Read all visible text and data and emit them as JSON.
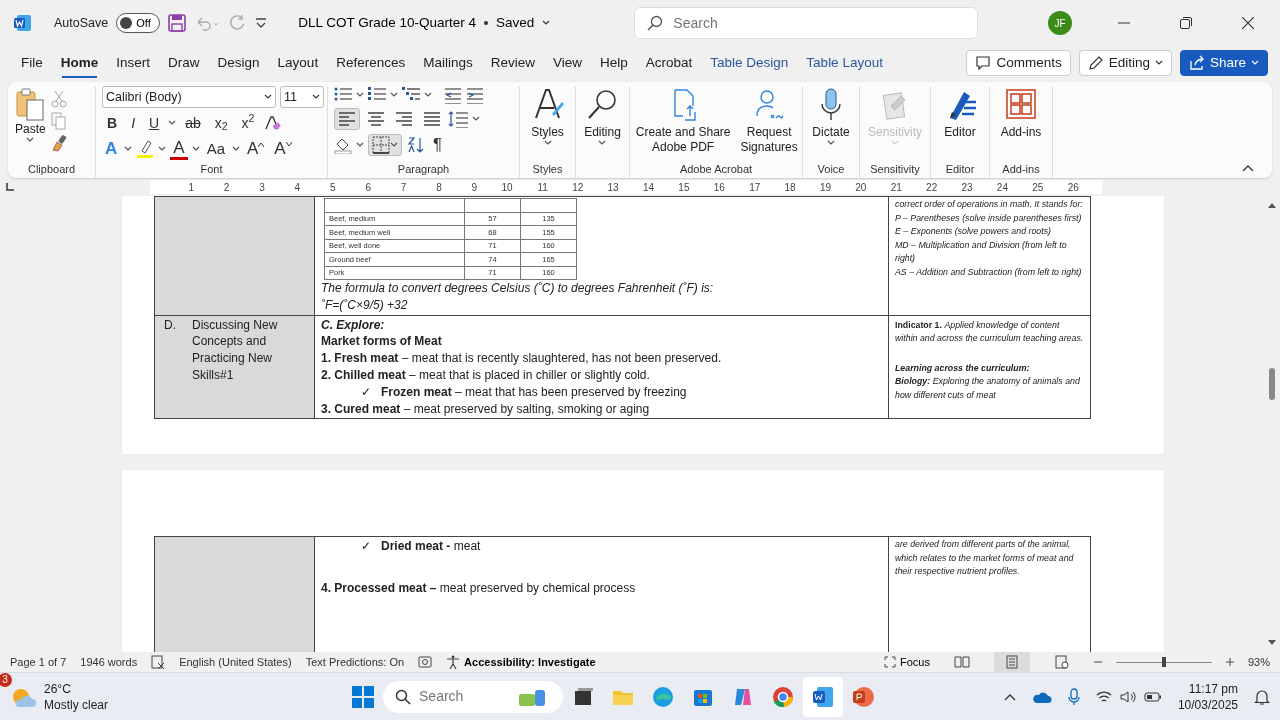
{
  "title_bar": {
    "autosave_label": "AutoSave",
    "autosave": {
      "on": false,
      "label": "Off"
    },
    "document_title": "DLL COT Grade 10-Quarter 4",
    "save_status": "Saved",
    "search": {
      "placeholder": "Search"
    },
    "avatar_initials": "JF"
  },
  "menu_tabs": [
    {
      "label": "File",
      "selected": false,
      "kind": "normal"
    },
    {
      "label": "Home",
      "selected": true,
      "kind": "normal"
    },
    {
      "label": "Insert",
      "selected": false,
      "kind": "normal"
    },
    {
      "label": "Draw",
      "selected": false,
      "kind": "normal"
    },
    {
      "label": "Design",
      "selected": false,
      "kind": "normal"
    },
    {
      "label": "Layout",
      "selected": false,
      "kind": "normal"
    },
    {
      "label": "References",
      "selected": false,
      "kind": "normal"
    },
    {
      "label": "Mailings",
      "selected": false,
      "kind": "normal"
    },
    {
      "label": "Review",
      "selected": false,
      "kind": "normal"
    },
    {
      "label": "View",
      "selected": false,
      "kind": "normal"
    },
    {
      "label": "Help",
      "selected": false,
      "kind": "normal"
    },
    {
      "label": "Acrobat",
      "selected": false,
      "kind": "normal"
    },
    {
      "label": "Table Design",
      "selected": false,
      "kind": "contextual"
    },
    {
      "label": "Table Layout",
      "selected": false,
      "kind": "contextual"
    }
  ],
  "header_buttons": [
    {
      "label": "Comments",
      "kind": "comments"
    },
    {
      "label": "Editing",
      "kind": "editing"
    },
    {
      "label": "Share",
      "kind": "share"
    }
  ],
  "ribbon": {
    "clipboard": {
      "label": "Clipboard",
      "paste": "Paste"
    },
    "font": {
      "label": "Font",
      "font_name": "Calibri (Body)",
      "font_size": "11",
      "format_buttons": [
        "B",
        "I",
        "U",
        "ab",
        "x$_{2}$",
        "x$^{2}$"
      ],
      "effect_buttons": [
        {
          "kind": "effects",
          "glyph": "A"
        },
        {
          "kind": "highlight"
        },
        {
          "kind": "color",
          "glyph": "A"
        },
        {
          "kind": "case",
          "glyph": "Aa"
        },
        {
          "kind": "grow",
          "glyph": "A"
        },
        {
          "kind": "shrink",
          "glyph": "A"
        }
      ]
    },
    "paragraph": {
      "label": "Paragraph",
      "align_buttons": [
        {
          "kind": "left",
          "selected": true
        },
        {
          "kind": "center",
          "selected": false
        },
        {
          "kind": "right",
          "selected": false
        },
        {
          "kind": "justify",
          "selected": false
        }
      ],
      "pilcrow": "¶"
    },
    "groups": [
      {
        "label": "Styles",
        "buttons": [
          {
            "label": "Styles",
            "kind": "styles",
            "dropdown": true,
            "disabled": false
          }
        ]
      },
      {
        "buttons": [
          {
            "label": "Editing",
            "kind": "search",
            "dropdown": true,
            "disabled": false
          }
        ]
      },
      {
        "label": "Adobe Acrobat",
        "buttons": [
          {
            "label": "Create and Share Adobe PDF",
            "kind": "pdf",
            "dropdown": false,
            "disabled": false
          },
          {
            "label": "Request Signatures",
            "kind": "signature",
            "dropdown": false,
            "disabled": false
          }
        ]
      },
      {
        "label": "Voice",
        "buttons": [
          {
            "label": "Dictate",
            "kind": "mic",
            "dropdown": true,
            "disabled": false
          }
        ]
      },
      {
        "label": "Sensitivity",
        "buttons": [
          {
            "label": "Sensitivity",
            "kind": "sensitivity",
            "dropdown": true,
            "disabled": true
          }
        ]
      },
      {
        "label": "Editor",
        "buttons": [
          {
            "label": "Editor",
            "kind": "editor",
            "dropdown": false,
            "disabled": false
          }
        ]
      },
      {
        "label": "Add-ins",
        "buttons": [
          {
            "label": "Add-ins",
            "kind": "addins",
            "dropdown": false,
            "disabled": false
          }
        ]
      }
    ]
  },
  "ruler_numbers": [
    "1",
    "2",
    "3",
    "4",
    "5",
    "6",
    "7",
    "8",
    "9",
    "10",
    "11",
    "12",
    "13",
    "14",
    "15",
    "16",
    "17",
    "18",
    "19",
    "20",
    "21",
    "22",
    "23",
    "24",
    "25",
    "26"
  ],
  "document": {
    "temperature_rows": [
      [
        "Beef, medium",
        "57",
        "135"
      ],
      [
        "Beef, medium well",
        "68",
        "155"
      ],
      [
        "Beef, well done",
        "71",
        "160"
      ],
      [
        "Ground beef",
        "74",
        "165"
      ],
      [
        "Pork",
        "71",
        "160"
      ]
    ],
    "formula_lines": [
      "The formula to convert degrees Celsius (˚C) to degrees Fahrenheit (˚F) is:",
      "˚F=(˚C×9/5) +32"
    ],
    "right_top_lines": [
      "correct order of operations in math. It stands for:",
      "P – Parentheses (solve inside parentheses first)",
      "E – Exponents (solve powers and roots)",
      "MD – Multiplication and Division (from left to right)",
      "AS – Addition and Subtraction (from left to right)"
    ],
    "row_d": {
      "letter": "D.",
      "label": "Discussing New Concepts and Practicing New Skills#1",
      "lines": [
        {
          "kind": "italic-heading",
          "text": "C. Explore:"
        },
        {
          "kind": "heading",
          "text": "Market forms of Meat"
        },
        {
          "kind": "item",
          "text": "**1. Fresh meat** – meat that is recently slaughtered, has not been preserved."
        },
        {
          "kind": "item",
          "text": "**2. Chilled meat** – meat that is placed in chiller or slightly cold."
        },
        {
          "kind": "sub",
          "mark": "✓",
          "text": "**Frozen meat** – meat that has been preserved by freezing"
        },
        {
          "kind": "item",
          "text": "**3. Cured meat** – meat preserved by salting, smoking or aging"
        }
      ],
      "indicator": "**Indicator 1.** *Applied knowledge of content within and across the curriculum teaching areas.*",
      "learning_heading": "Learning across the curriculum:",
      "learning_text": "**Biology:** Exploring the anatomy of animals and how different cuts of meat"
    },
    "page2": {
      "lines": [
        {
          "kind": "sub",
          "mark": "✓",
          "text": "**Dried meat -** meat"
        },
        {
          "kind": "item",
          "text": "**4. Processed meat –** meat preserved by chemical process"
        }
      ],
      "right_text": "are derived from different parts of the animal, which relates to the market forms of meat and their respective nutrient profiles."
    }
  },
  "status_bar": {
    "page": "Page 1 of 7",
    "words": "1946 words",
    "language": "English (United States)",
    "predictions": "Text Predictions: On",
    "accessibility": "Accessibility: Investigate",
    "focus": "Focus",
    "view_buttons": [
      {
        "kind": "read",
        "selected": false
      },
      {
        "kind": "print",
        "selected": true
      },
      {
        "kind": "web",
        "selected": false
      }
    ],
    "zoom": {
      "level": 0.5,
      "label": "93%"
    }
  },
  "taskbar": {
    "weather_badge": "3",
    "temperature": "26°C",
    "condition": "Mostly clear",
    "search": {
      "placeholder": "Search"
    },
    "time": "11:17 pm",
    "date": "10/03/2025"
  }
}
